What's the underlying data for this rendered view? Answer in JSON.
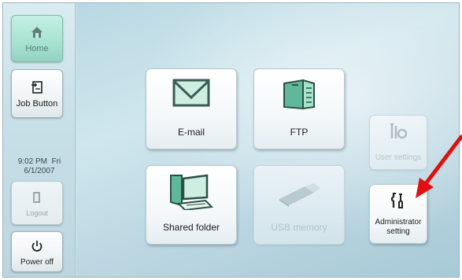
{
  "sidebar": {
    "home_label": "Home",
    "job_label": "Job Button",
    "clock_time": "9:02 PM  Fri",
    "clock_date": "6/1/2007",
    "logout_label": "Logout",
    "power_label": "Power off"
  },
  "tiles": {
    "email_label": "E-mail",
    "ftp_label": "FTP",
    "shared_label": "Shared folder",
    "usb_label": "USB memory",
    "user_settings_label": "User settings",
    "admin_label_line1": "Administrator",
    "admin_label_line2": "setting"
  },
  "icons": {
    "home": "home-icon",
    "job": "job-button-icon",
    "logout": "logout-icon",
    "power": "power-icon",
    "email": "envelope-icon",
    "ftp": "ftp-server-icon",
    "shared": "shared-folder-computer-icon",
    "usb": "usb-memory-icon",
    "user_settings": "user-settings-tools-icon",
    "admin": "wrench-screwdriver-icon"
  },
  "colors": {
    "accent_green": "#5fb89a",
    "home_active": "#a7e2d1",
    "annotation_arrow": "#e01010"
  }
}
